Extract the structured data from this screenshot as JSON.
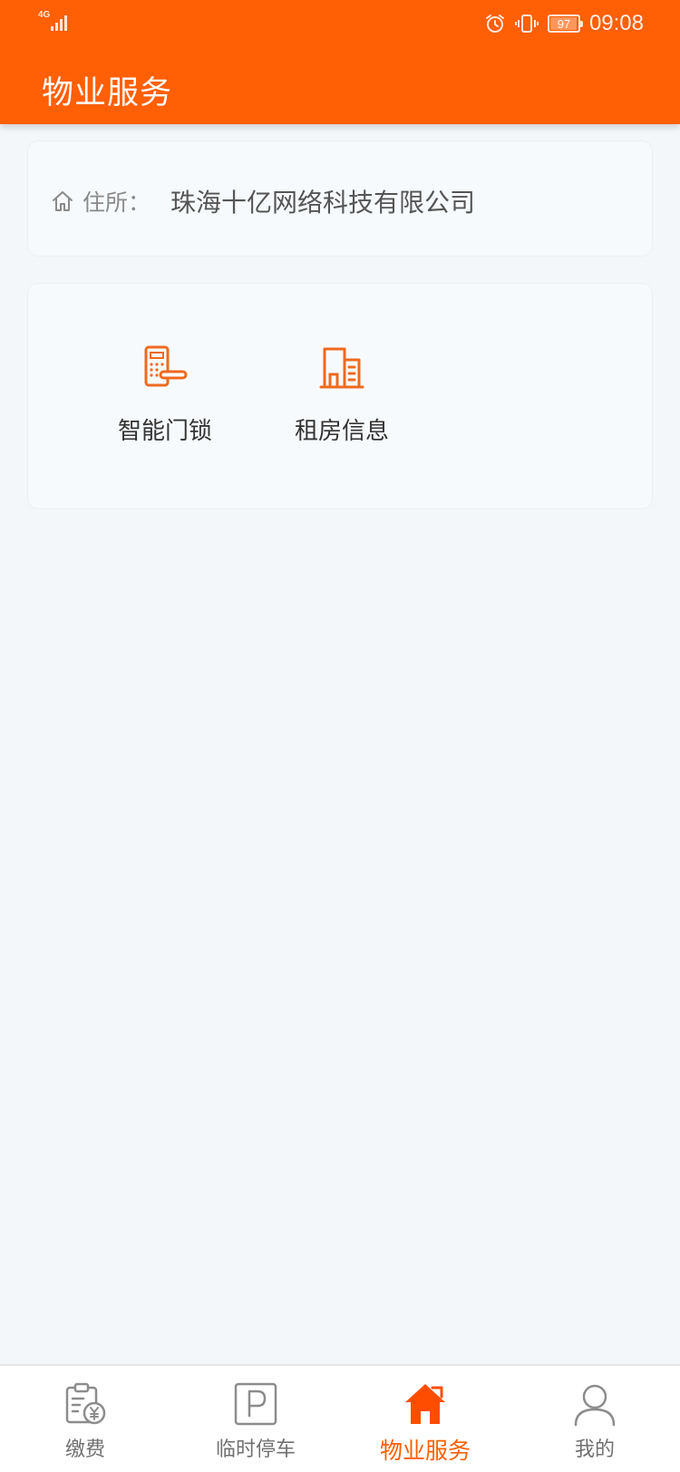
{
  "status_bar": {
    "network": "4G",
    "battery": "97",
    "battery_level": 0.97,
    "time": "09:08"
  },
  "header": {
    "title": "物业服务",
    "color": "#ff5f05"
  },
  "address": {
    "label": "住所：",
    "value": "珠海十亿网络科技有限公司"
  },
  "services": [
    {
      "label": "智能门锁",
      "icon": "smart-lock-icon"
    },
    {
      "label": "租房信息",
      "icon": "building-icon"
    }
  ],
  "bottom_nav": [
    {
      "label": "缴费",
      "icon": "payment-bill-icon",
      "active": false
    },
    {
      "label": "临时停车",
      "icon": "parking-icon",
      "active": false
    },
    {
      "label": "物业服务",
      "icon": "home-icon",
      "active": true
    },
    {
      "label": "我的",
      "icon": "user-icon",
      "active": false
    }
  ],
  "colors": {
    "accent": "#ff5f05",
    "active_icon": "#ff4d00",
    "inactive": "#8c8c8c"
  }
}
